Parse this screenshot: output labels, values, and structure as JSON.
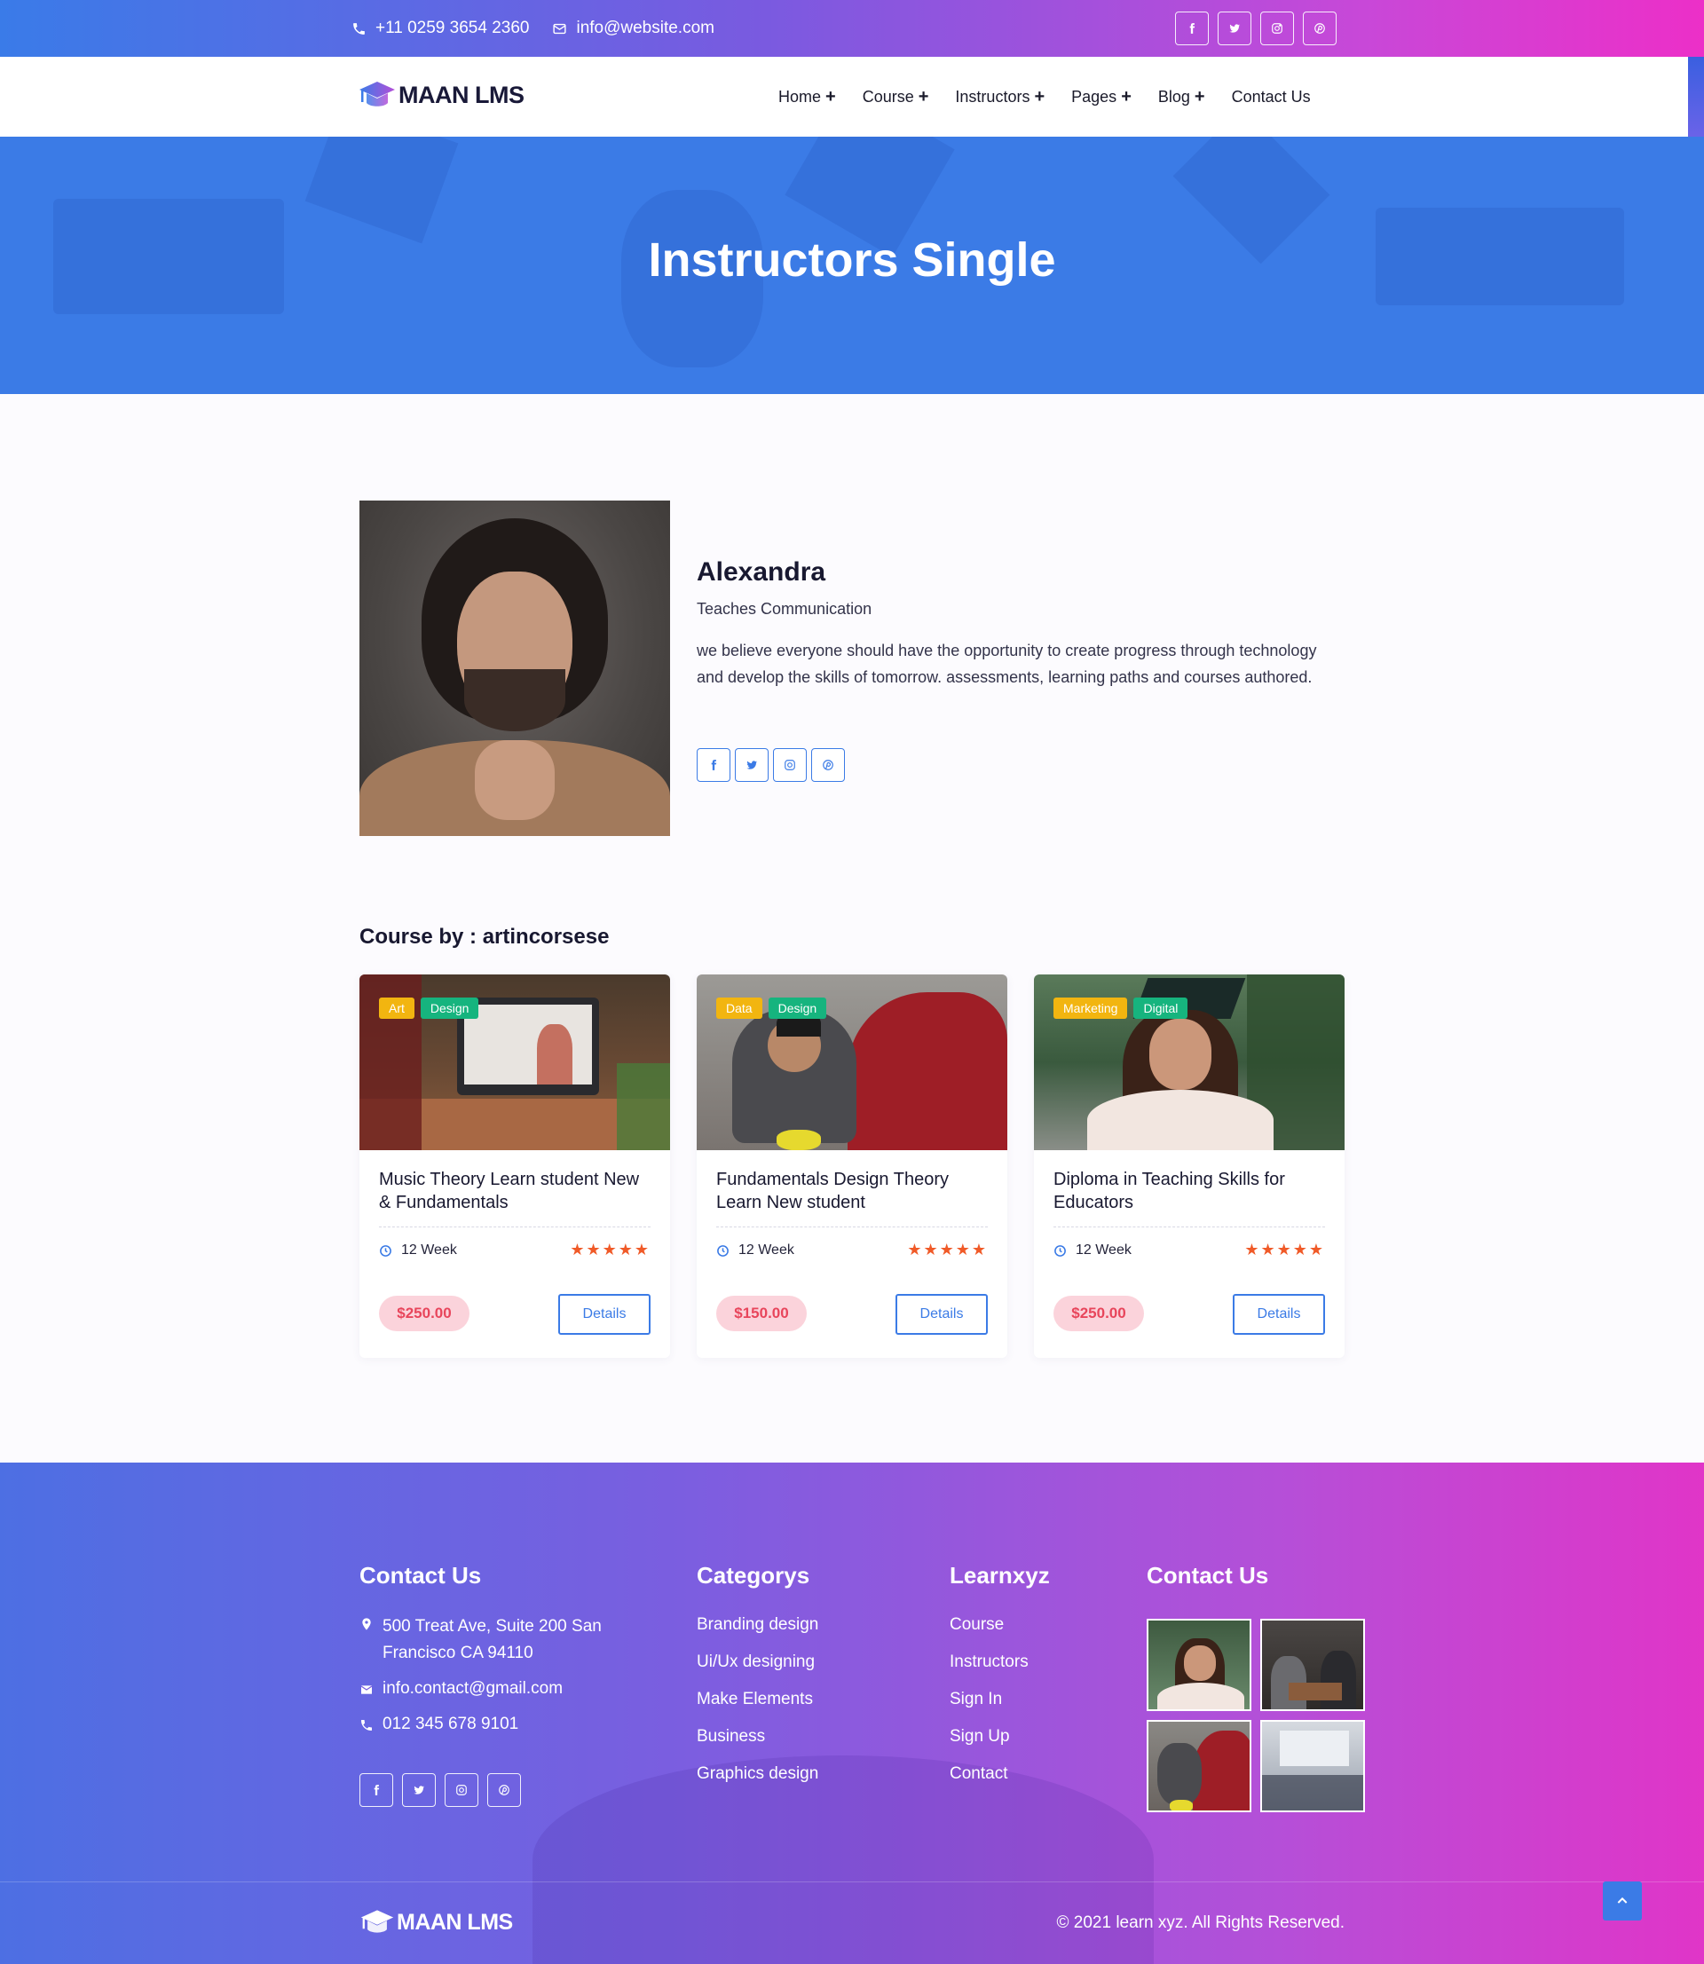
{
  "topbar": {
    "phone": "+11 0259 3654 2360",
    "email": "info@website.com",
    "socials": [
      "facebook-icon",
      "twitter-icon",
      "instagram-icon",
      "pinterest-icon"
    ]
  },
  "header": {
    "logo_text": "MAAN LMS",
    "nav": [
      {
        "label": "Home",
        "has_submenu": true
      },
      {
        "label": "Course",
        "has_submenu": true
      },
      {
        "label": "Instructors",
        "has_submenu": true
      },
      {
        "label": "Pages",
        "has_submenu": true
      },
      {
        "label": "Blog",
        "has_submenu": true
      },
      {
        "label": "Contact Us",
        "has_submenu": false
      }
    ]
  },
  "hero": {
    "title": "Instructors Single"
  },
  "instructor": {
    "name": "Alexandra",
    "role": "Teaches Communication",
    "bio": "we believe everyone should have the opportunity to create progress through technology and develop the skills of tomorrow. assessments, learning paths and courses authored.",
    "socials": [
      "facebook-icon",
      "twitter-icon",
      "instagram-icon",
      "pinterest-icon"
    ]
  },
  "courses_section": {
    "title": "Course by : artincorsese"
  },
  "courses": [
    {
      "tags": [
        "Art",
        "Design"
      ],
      "title": "Music Theory Learn student New & Fundamentals",
      "duration": "12 Week",
      "rating": 5,
      "stars": "★★★★★",
      "price": "$250.00",
      "cta": "Details"
    },
    {
      "tags": [
        "Data",
        "Design"
      ],
      "title": "Fundamentals Design Theory Learn New student",
      "duration": "12 Week",
      "rating": 5,
      "stars": "★★★★★",
      "price": "$150.00",
      "cta": "Details"
    },
    {
      "tags": [
        "Marketing",
        "Digital"
      ],
      "title": "Diploma in Teaching Skills for Educators",
      "duration": "12 Week",
      "rating": 5,
      "stars": "★★★★★",
      "price": "$250.00",
      "cta": "Details"
    }
  ],
  "footer": {
    "contact": {
      "heading": "Contact Us",
      "address": "500 Treat Ave, Suite 200 San Francisco CA 94110",
      "email": "info.contact@gmail.com",
      "phone": "012 345 678 9101",
      "socials": [
        "facebook-icon",
        "twitter-icon",
        "instagram-icon",
        "pinterest-icon"
      ]
    },
    "categories": {
      "heading": "Categorys",
      "items": [
        "Branding design",
        "Ui/Ux designing",
        "Make Elements",
        "Business",
        "Graphics design"
      ]
    },
    "links": {
      "heading": "Learnxyz",
      "items": [
        "Course",
        "Instructors",
        "Sign In",
        "Sign Up",
        "Contact"
      ]
    },
    "gallery": {
      "heading": "Contact Us"
    },
    "logo_text": "MAAN LMS",
    "copyright": "© 2021 learn xyz. All Rights Reserved."
  },
  "colors": {
    "primary": "#3b7be6",
    "gradient_start": "#3a7be8",
    "gradient_end": "#ec2fc8",
    "price_bg": "#fbd3db",
    "price_text": "#e8455b",
    "tag_yellow": "#f2b510",
    "tag_green": "#16b47e",
    "star": "#f05a28"
  }
}
